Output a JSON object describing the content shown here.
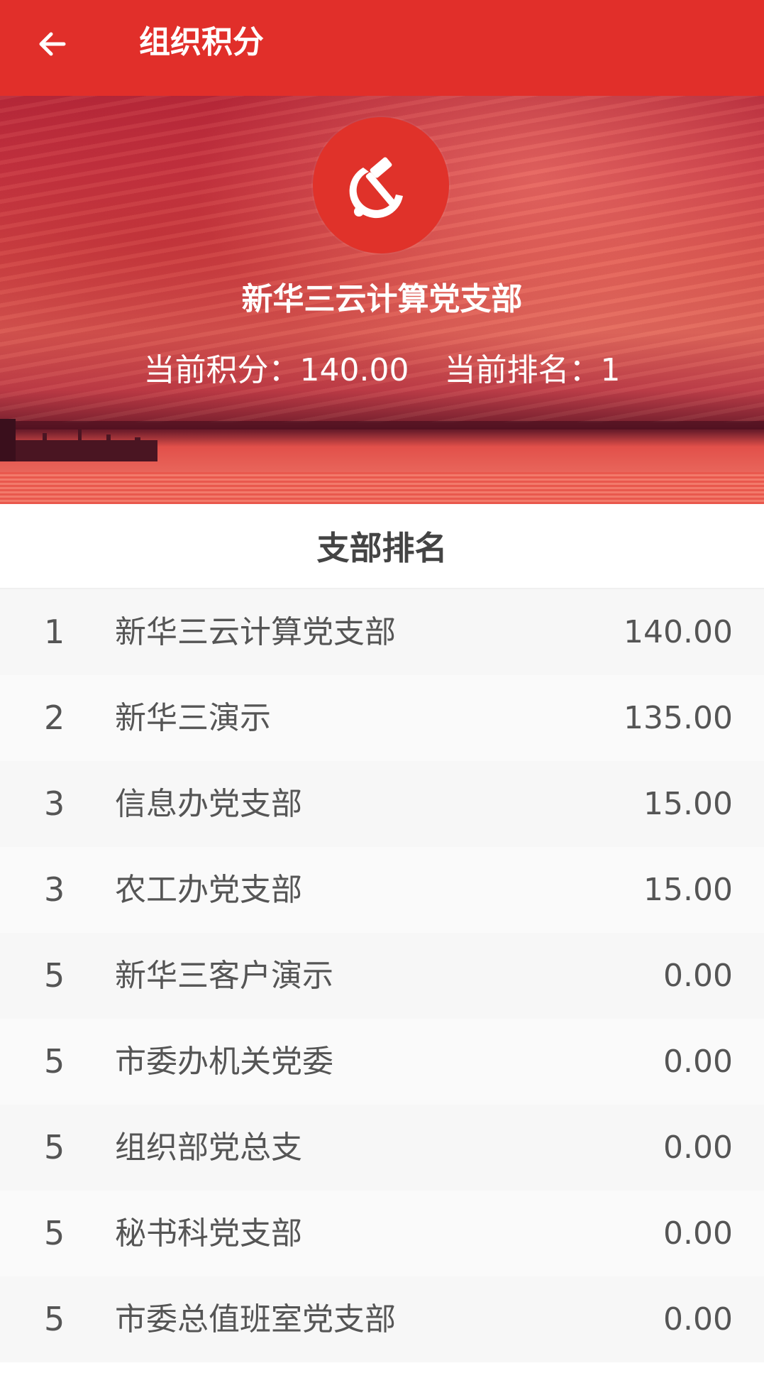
{
  "topbar": {
    "title": "组织积分",
    "back_icon": "arrow-left-icon",
    "color": "#e12f2a"
  },
  "hero": {
    "emblem_icon": "hammer-sickle-icon",
    "branch_name": "新华三云计算党支部",
    "current_score_label": "当前积分：",
    "current_score": "140.00",
    "current_rank_label": "当前排名：",
    "current_rank": "1"
  },
  "ranking": {
    "title": "支部排名",
    "rows": [
      {
        "rank": "1",
        "name": "新华三云计算党支部",
        "score": "140.00"
      },
      {
        "rank": "2",
        "name": "新华三演示",
        "score": "135.00"
      },
      {
        "rank": "3",
        "name": "信息办党支部",
        "score": "15.00"
      },
      {
        "rank": "3",
        "name": "农工办党支部",
        "score": "15.00"
      },
      {
        "rank": "5",
        "name": "新华三客户演示",
        "score": "0.00"
      },
      {
        "rank": "5",
        "name": "市委办机关党委",
        "score": "0.00"
      },
      {
        "rank": "5",
        "name": "组织部党总支",
        "score": "0.00"
      },
      {
        "rank": "5",
        "name": "秘书科党支部",
        "score": "0.00"
      },
      {
        "rank": "5",
        "name": "市委总值班室党支部",
        "score": "0.00"
      }
    ]
  }
}
